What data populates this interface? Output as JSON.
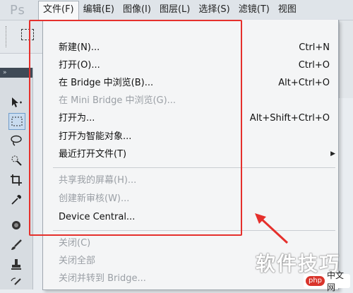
{
  "app": {
    "logo": "Ps",
    "menubar": [
      {
        "label": "文件(F)",
        "active": true
      },
      {
        "label": "编辑(E)"
      },
      {
        "label": "图像(I)"
      },
      {
        "label": "图层(L)"
      },
      {
        "label": "选择(S)"
      },
      {
        "label": "滤镜(T)"
      },
      {
        "label": "视图"
      }
    ]
  },
  "file_menu": {
    "items": [
      {
        "label": "新建(N)...",
        "shortcut": "Ctrl+N",
        "disabled": false
      },
      {
        "label": "打开(O)...",
        "shortcut": "Ctrl+O",
        "disabled": false
      },
      {
        "label": "在 Bridge 中浏览(B)...",
        "shortcut": "Alt+Ctrl+O",
        "disabled": false
      },
      {
        "label": "在 Mini Bridge 中浏览(G)...",
        "shortcut": "",
        "disabled": true
      },
      {
        "label": "打开为...",
        "shortcut": "Alt+Shift+Ctrl+O",
        "disabled": false
      },
      {
        "label": "打开为智能对象...",
        "shortcut": "",
        "disabled": false
      },
      {
        "label": "最近打开文件(T)",
        "shortcut": "",
        "disabled": false,
        "submenu": true
      },
      {
        "label": "共享我的屏幕(H)...",
        "shortcut": "",
        "disabled": true
      },
      {
        "label": "创建新审核(W)...",
        "shortcut": "",
        "disabled": true
      },
      {
        "label": "Device Central...",
        "shortcut": "",
        "disabled": false
      },
      {
        "label": "关闭(C)",
        "shortcut": "",
        "disabled": true
      },
      {
        "label": "关闭全部",
        "shortcut": "",
        "disabled": true
      },
      {
        "label": "关闭并转到 Bridge...",
        "shortcut": "",
        "disabled": true
      }
    ]
  },
  "tools": [
    "move-tool-icon",
    "marquee-tool-icon",
    "lasso-tool-icon",
    "quick-select-tool-icon",
    "crop-tool-icon",
    "eyedropper-tool-icon",
    "healing-brush-tool-icon",
    "brush-tool-icon",
    "clone-stamp-tool-icon",
    "history-brush-tool-icon"
  ],
  "annotation": {
    "color": "#e5302c"
  },
  "watermark": {
    "text": "软件技巧",
    "logo_badge": "php",
    "logo_text": "中文网"
  }
}
